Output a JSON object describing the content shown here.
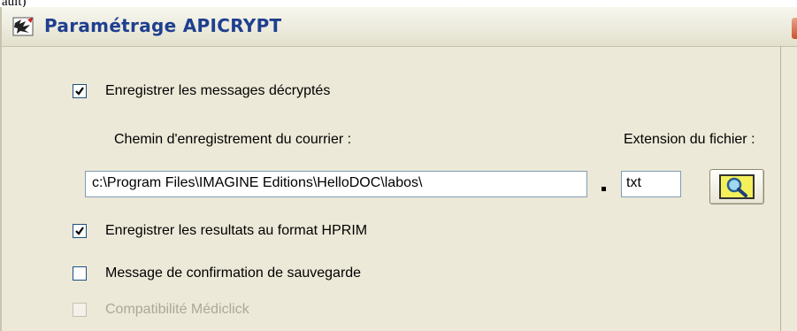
{
  "top_fragment": "ault)",
  "window": {
    "title": "Paramétrage APICRYPT",
    "icon": "apicrypt-app-icon"
  },
  "settings": {
    "save_decrypted": {
      "label": "Enregistrer les messages décryptés",
      "checked": true
    },
    "path_label": "Chemin d'enregistrement du courrier :",
    "extension_label": "Extension du fichier :",
    "path_value": "c:\\Program Files\\IMAGINE Editions\\HelloDOC\\labos\\",
    "extension_value": "txt",
    "browse_icon": "magnifier-icon",
    "save_hprim": {
      "label": "Enregistrer les resultats au format HPRIM",
      "checked": true
    },
    "confirm_message": {
      "label": "Message de confirmation de sauvegarde",
      "checked": false
    },
    "mediclick_compat": {
      "label": "Compatibilité Médiclick",
      "checked": false,
      "disabled": true
    }
  }
}
